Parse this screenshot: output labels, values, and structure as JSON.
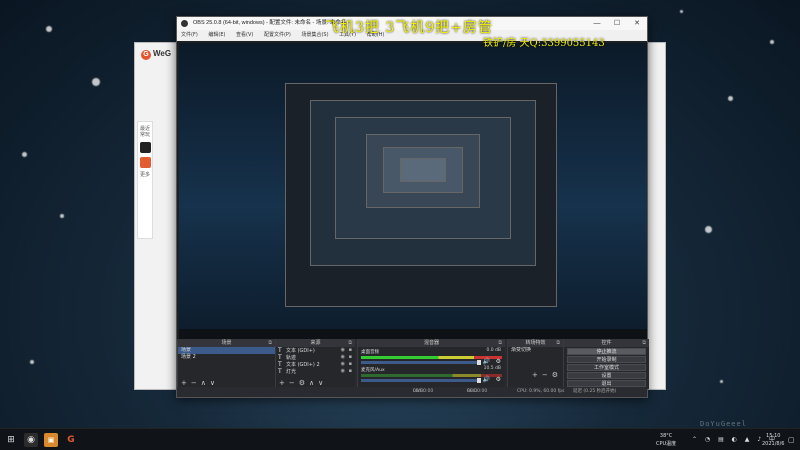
{
  "overlay": {
    "line1": "飞机3把 3飞机9把+房管",
    "line2": "铁铲/房 天Q:3399055143"
  },
  "bg_app": {
    "logo": "WeG",
    "side_label": "最近 常玩",
    "side_more": "更多"
  },
  "obs": {
    "title": "OBS 25.0.8 (64-bit, windows) - 配置文件: 未命名 - 场景: 未命名",
    "menu": [
      "文件(F)",
      "编辑(E)",
      "查看(V)",
      "配置文件(P)",
      "场景集合(S)",
      "工具(T)",
      "帮助(H)"
    ],
    "docks": {
      "scenes": "场景",
      "sources": "来源",
      "mixer": "混音器",
      "transitions": "转场特效",
      "controls": "控件"
    },
    "scenes": [
      "场景",
      "场景 2"
    ],
    "sources": [
      {
        "name": "文本 (GDI+)"
      },
      {
        "name": "轨迹"
      },
      {
        "name": "文本 (GDI+) 2"
      },
      {
        "name": "灯光"
      }
    ],
    "mixer": [
      {
        "name": "桌面音频",
        "db": "0.0 dB"
      },
      {
        "name": "麦克风/Aux",
        "db": "10.5 dB"
      }
    ],
    "transition": {
      "selected": "淡出",
      "label": "渐变切换"
    },
    "controls": [
      "停止推流",
      "开始录制",
      "工作室模式",
      "设置",
      "退出"
    ],
    "status": {
      "live_label": "LIVE:",
      "live_time": "00:00:00",
      "rec_label": "REC:",
      "rec_time": "00:00:00",
      "cpu": "CPU: 0.9%, 60.00 fps",
      "extra": "延迟 (0.25 秒后开始)"
    }
  },
  "taskbar": {
    "temp": "38°C",
    "temp_label": "CPU温度",
    "time": "15:10",
    "date": "2021/8/6",
    "watermark": "DoYuGeeel"
  }
}
